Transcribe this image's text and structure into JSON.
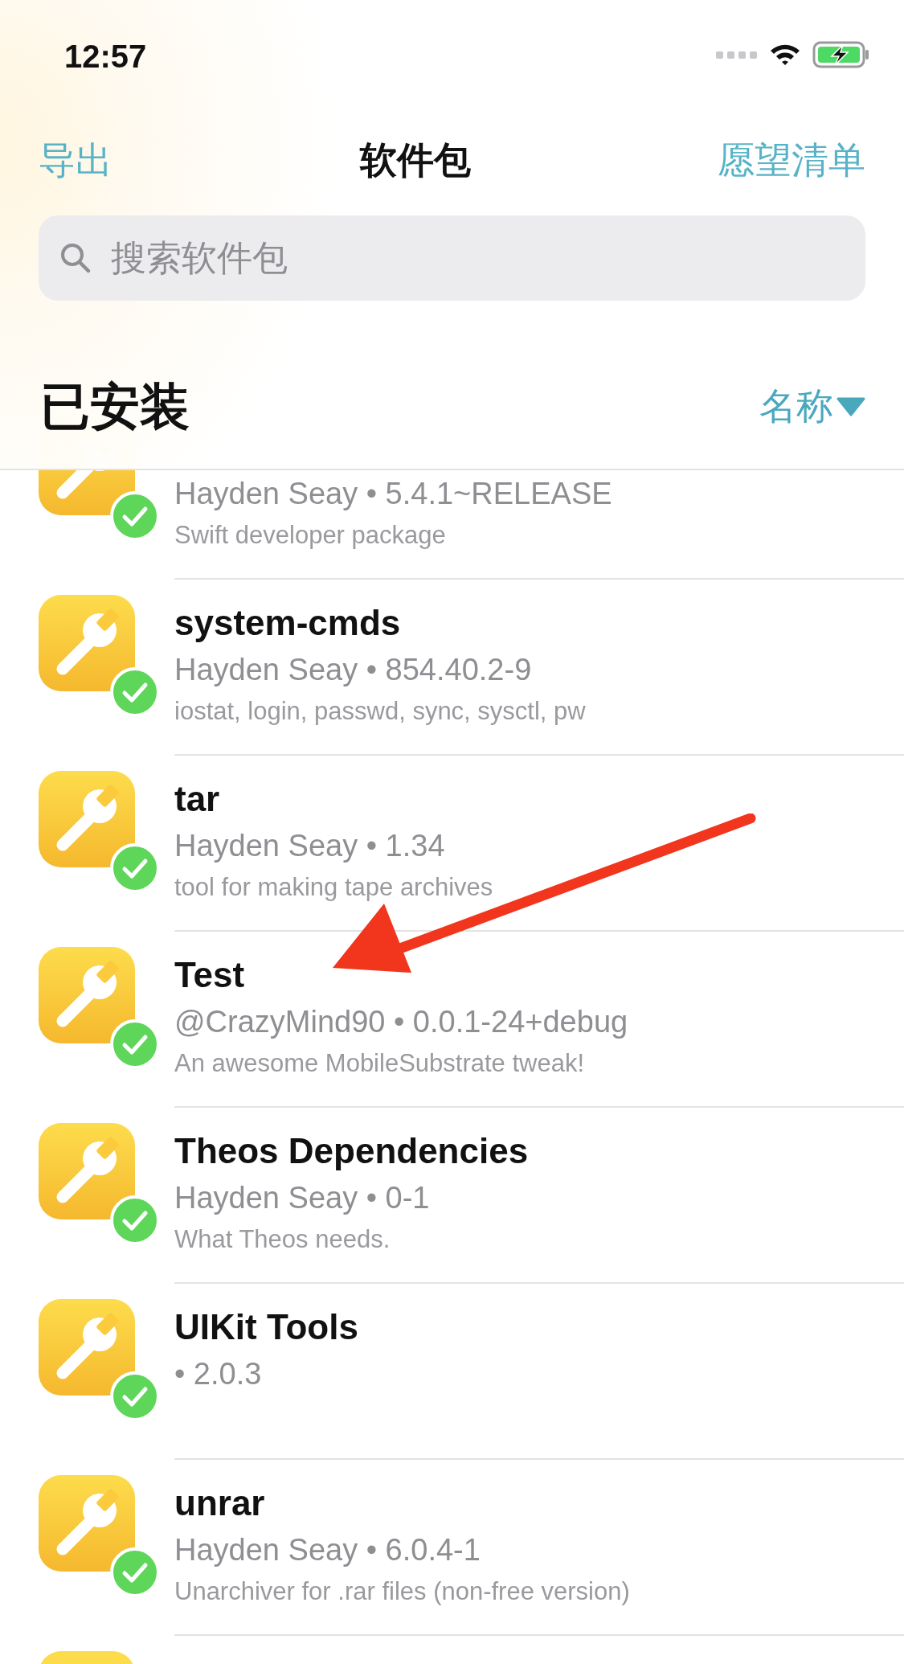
{
  "status_bar": {
    "time": "12:57"
  },
  "nav": {
    "left": "导出",
    "title": "软件包",
    "right": "愿望清单"
  },
  "search": {
    "placeholder": "搜索软件包"
  },
  "section": {
    "title": "已安装",
    "sort": "名称"
  },
  "packages": [
    {
      "meta": "Hayden Seay • 5.4.1~RELEASE",
      "description": "Swift developer package",
      "installed": true
    },
    {
      "name": "system-cmds",
      "meta": "Hayden Seay • 854.40.2-9",
      "description": "iostat, login, passwd, sync, sysctl, pw",
      "installed": true
    },
    {
      "name": "tar",
      "meta": "Hayden Seay • 1.34",
      "description": "tool for making tape archives",
      "installed": true
    },
    {
      "name": "Test",
      "meta": "@CrazyMind90 • 0.0.1-24+debug",
      "description": "An awesome MobileSubstrate tweak!",
      "installed": true
    },
    {
      "name": "Theos Dependencies",
      "meta": "Hayden Seay • 0-1",
      "description": "What Theos needs.",
      "installed": true
    },
    {
      "name": "UIKit Tools",
      "meta": "• 2.0.3",
      "installed": true
    },
    {
      "name": "unrar",
      "meta": "Hayden Seay • 6.0.4-1",
      "description": "Unarchiver for .rar files (non-free version)",
      "installed": true
    }
  ]
}
